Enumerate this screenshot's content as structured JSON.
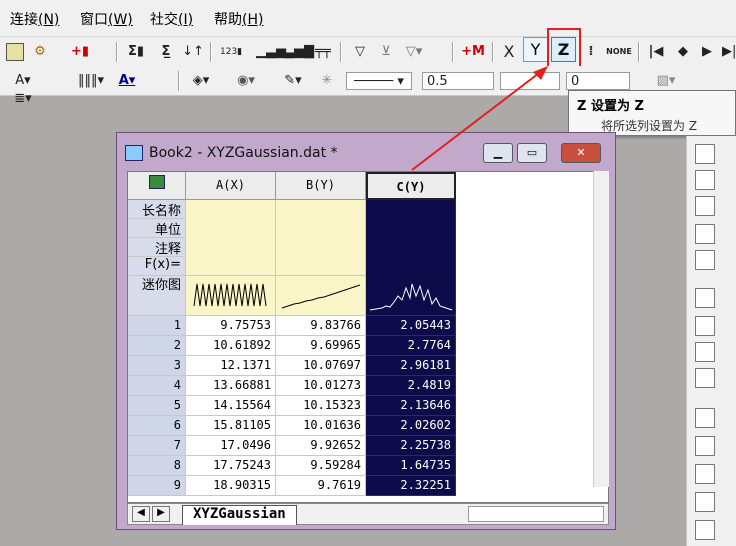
{
  "menubar": {
    "items": [
      {
        "label": "连接",
        "key": "(N)"
      },
      {
        "label": "窗口",
        "key": "(W)"
      },
      {
        "label": "社交",
        "key": "(I)"
      },
      {
        "label": "帮助",
        "key": "(H)"
      }
    ]
  },
  "toolbar": {
    "y_label": "Y",
    "z_label": "Z",
    "x_label": "X",
    "none_label": "NONE",
    "line_width": "0.5",
    "number_value": "0"
  },
  "tooltip": {
    "title": "Z  设置为 Z",
    "description": "将所选列设置为 Z"
  },
  "window": {
    "title": "Book2 - XYZGaussian.dat *",
    "columns": [
      "A(X)",
      "B(Y)",
      "C(Y)"
    ],
    "row_labels": [
      "长名称",
      "单位",
      "注释",
      "F(x)=",
      "迷你图"
    ],
    "rows": [
      {
        "index": "1",
        "a": "9.75753",
        "b": "9.83766",
        "c": "2.05443"
      },
      {
        "index": "2",
        "a": "10.61892",
        "b": "9.69965",
        "c": "2.7764"
      },
      {
        "index": "3",
        "a": "12.1371",
        "b": "10.07697",
        "c": "2.96181"
      },
      {
        "index": "4",
        "a": "13.66881",
        "b": "10.01273",
        "c": "2.4819"
      },
      {
        "index": "5",
        "a": "14.15564",
        "b": "10.15323",
        "c": "2.13646"
      },
      {
        "index": "6",
        "a": "15.81105",
        "b": "10.01636",
        "c": "2.02602"
      },
      {
        "index": "7",
        "a": "17.0496",
        "b": "9.92652",
        "c": "2.25738"
      },
      {
        "index": "8",
        "a": "17.75243",
        "b": "9.59284",
        "c": "1.64735"
      },
      {
        "index": "9",
        "a": "18.90315",
        "b": "9.7619",
        "c": "2.32251"
      }
    ],
    "sheet_tab": "XYZGaussian"
  },
  "colors": {
    "highlight": "#e4201f",
    "selected_column": "#0d0b4a",
    "window_frame": "#c2a9cc"
  }
}
